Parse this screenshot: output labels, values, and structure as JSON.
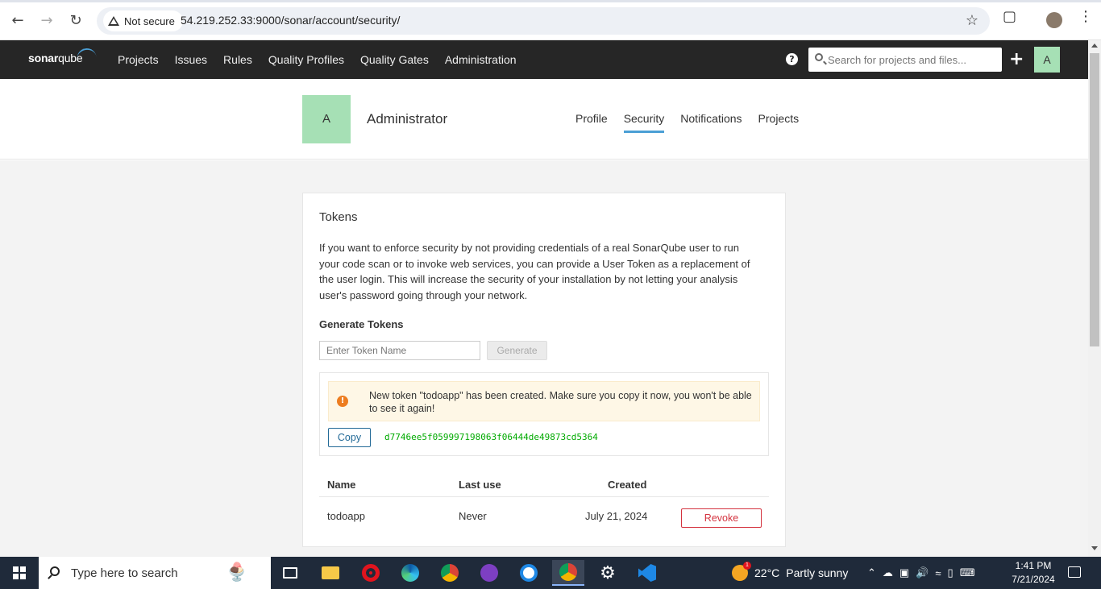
{
  "browser": {
    "security_label": "Not secure",
    "url": "54.219.252.33:9000/sonar/account/security/"
  },
  "nav": {
    "logo_sonar": "sonar",
    "logo_qube": "qube",
    "items": [
      "Projects",
      "Issues",
      "Rules",
      "Quality Profiles",
      "Quality Gates",
      "Administration"
    ],
    "search_placeholder": "Search for projects and files...",
    "user_initial": "A"
  },
  "account": {
    "avatar_initial": "A",
    "name": "Administrator",
    "tabs": [
      "Profile",
      "Security",
      "Notifications",
      "Projects"
    ],
    "active_tab": "Security"
  },
  "tokens": {
    "title": "Tokens",
    "description": "If you want to enforce security by not providing credentials of a real SonarQube user to run your code scan or to invoke web services, you can provide a User Token as a replacement of the user login. This will increase the security of your installation by not letting your analysis user's password going through your network.",
    "generate_title": "Generate Tokens",
    "input_placeholder": "Enter Token Name",
    "generate_label": "Generate",
    "alert_text": "New token \"todoapp\" has been created. Make sure you copy it now, you won't be able to see it again!",
    "copy_label": "Copy",
    "token_value": "d7746ee5f059997198063f06444de49873cd5364",
    "table": {
      "headers": [
        "Name",
        "Last use",
        "Created"
      ],
      "rows": [
        {
          "name": "todoapp",
          "last_use": "Never",
          "created": "July 21, 2024",
          "action": "Revoke"
        }
      ]
    }
  },
  "taskbar": {
    "search_placeholder": "Type here to search",
    "weather_temp": "22°C",
    "weather_text": "Partly sunny",
    "weather_badge": "1",
    "time": "1:41 PM",
    "date": "7/21/2024"
  },
  "colors": {
    "nav_bg": "#262626",
    "accent": "#4b9fd5",
    "avatar_bg": "#a6e0b5",
    "revoke": "#d4333f",
    "token_text": "#00aa00",
    "alert_icon": "#ed7d20"
  }
}
